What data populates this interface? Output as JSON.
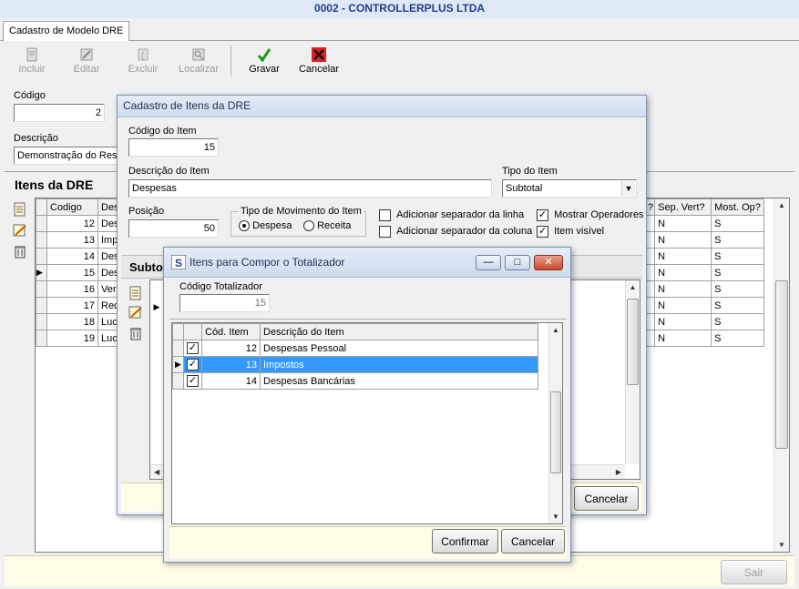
{
  "app_title": "0002 - CONTROLLERPLUS LTDA",
  "tab_label": "Cadastro de Modelo DRE",
  "toolbar": {
    "incluir": "Incluir",
    "editar": "Editar",
    "excluir": "Excluir",
    "localizar": "Localizar",
    "gravar": "Gravar",
    "cancelar": "Cancelar"
  },
  "form": {
    "codigo_label": "Código",
    "codigo_value": "2",
    "descricao_label": "Descrição",
    "descricao_value": "Demonstração do Resu"
  },
  "itens_title": "Itens da DRE",
  "main_grid": {
    "col_codigo": "Codigo",
    "col_des": "Des",
    "col_sep_vert": "Sep. Vert?",
    "col_most_op": "Most. Op?",
    "col_partial": "?",
    "rows": [
      {
        "codigo": "12",
        "des": "Des",
        "sep": "N",
        "most": "S"
      },
      {
        "codigo": "13",
        "des": "Imp",
        "sep": "N",
        "most": "S"
      },
      {
        "codigo": "14",
        "des": "Des",
        "sep": "N",
        "most": "S"
      },
      {
        "codigo": "15",
        "des": "Des",
        "sep": "N",
        "most": "S"
      },
      {
        "codigo": "16",
        "des": "Ver",
        "sep": "N",
        "most": "S"
      },
      {
        "codigo": "17",
        "des": "Rec",
        "sep": "N",
        "most": "S"
      },
      {
        "codigo": "18",
        "des": "Luc",
        "sep": "N",
        "most": "S"
      },
      {
        "codigo": "19",
        "des": "Luc",
        "sep": "N",
        "most": "S"
      }
    ]
  },
  "sair_label": "Sair",
  "item_dialog": {
    "title": "Cadastro de Itens da DRE",
    "codigo_label": "Código do Item",
    "codigo_value": "15",
    "descricao_label": "Descrição do Item",
    "descricao_value": "Despesas",
    "tipo_label": "Tipo do Item",
    "tipo_value": "Subtotal",
    "posicao_label": "Posição",
    "posicao_value": "50",
    "tipo_mov_label": "Tipo de Movimento do Item",
    "despesa_label": "Despesa",
    "receita_label": "Receita",
    "sep_linha_label": "Adicionar separador da linha",
    "sep_coluna_label": "Adicionar separador da coluna",
    "mostrar_op_label": "Mostrar Operadores",
    "item_visivel_label": "Item visível",
    "subtotal_partial": "Subto",
    "cancelar_label": "Cancelar"
  },
  "compor_dialog": {
    "title": "Itens para Compor o Totalizador",
    "codigo_label": "Código Totalizador",
    "codigo_value": "15",
    "col_cod": "Cód. Item",
    "col_desc": "Descrição do Item",
    "rows": [
      {
        "cod": "12",
        "desc": "Despesas Pessoal"
      },
      {
        "cod": "13",
        "desc": "Impostos"
      },
      {
        "cod": "14",
        "desc": "Despesas Bancárias"
      }
    ],
    "confirmar_label": "Confirmar",
    "cancelar_label": "Cancelar"
  },
  "colors": {
    "selection": "#3399ff",
    "footer": "#fffde7",
    "title_text": "#1f3f8f",
    "close_btn": "#c74b2c"
  }
}
